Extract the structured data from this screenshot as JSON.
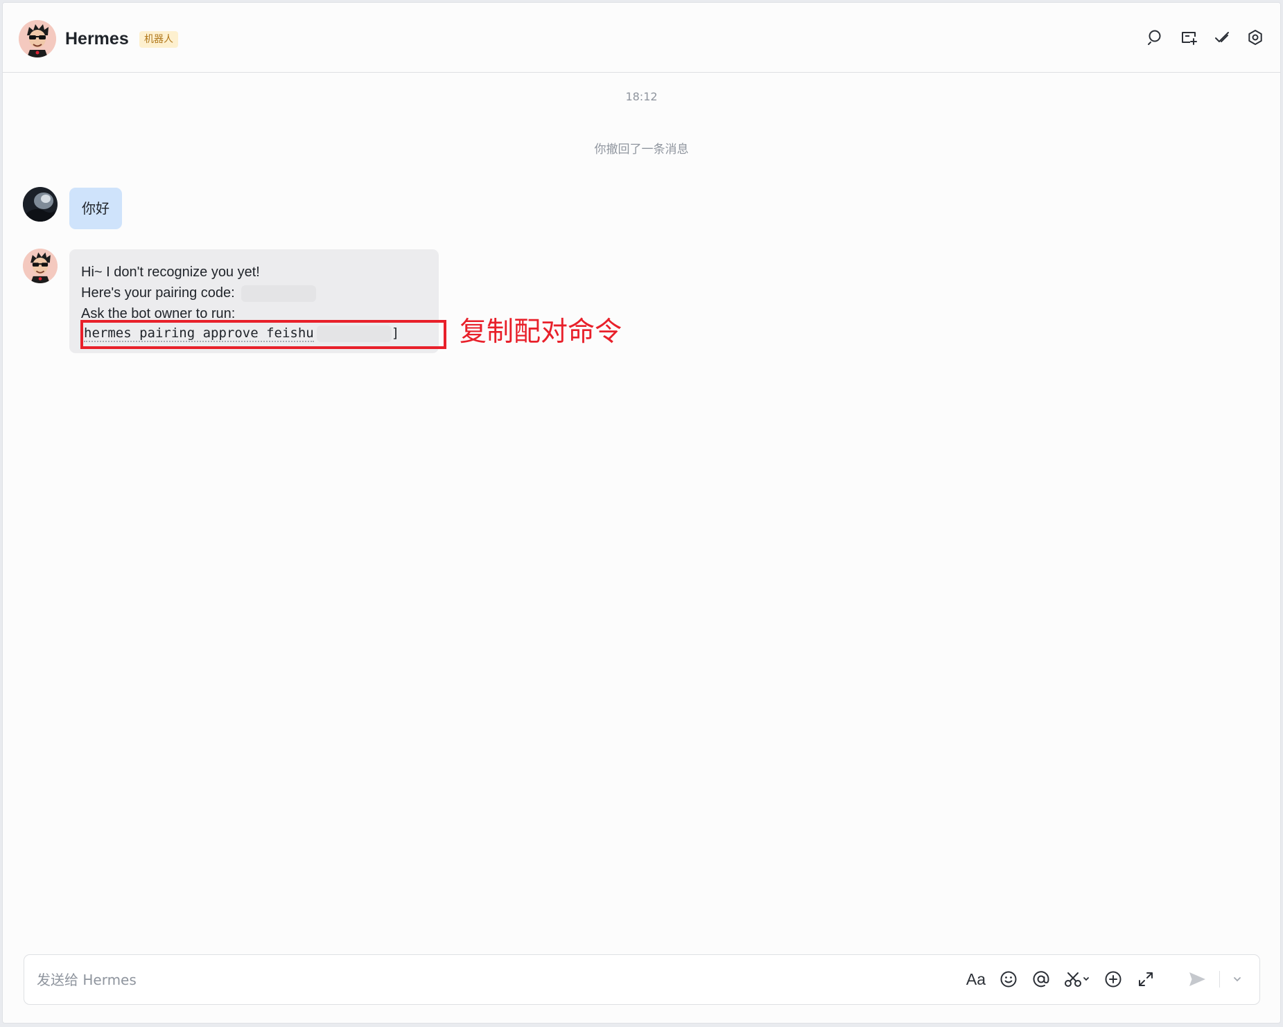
{
  "header": {
    "title": "Hermes",
    "badge": "机器人",
    "actions": [
      "search-icon",
      "add-tab-icon",
      "done-icon",
      "settings-icon"
    ]
  },
  "conversation": {
    "timestamp": "18:12",
    "recall_notice": "你撤回了一条消息",
    "user_message": "你好",
    "bot_message": {
      "line1": "Hi~ I don't recognize you yet!",
      "line2_prefix": "Here's your pairing code:",
      "line3": "Ask the bot owner to run:",
      "command": "hermes pairing approve feishu",
      "command_end": "]"
    }
  },
  "annotation": {
    "text": "复制配对命令",
    "color": "#e8202a"
  },
  "composer": {
    "placeholder": "发送给 Hermes",
    "format_label": "Aa",
    "tools": [
      "format-icon",
      "emoji-icon",
      "mention-icon",
      "screenshot-icon",
      "add-icon",
      "expand-icon",
      "send-icon",
      "send-options-icon"
    ]
  },
  "colors": {
    "user_bubble": "#cfe3fb",
    "bot_bubble": "#ececee",
    "badge_bg": "#fdf0cf",
    "badge_text": "#b1781b"
  }
}
